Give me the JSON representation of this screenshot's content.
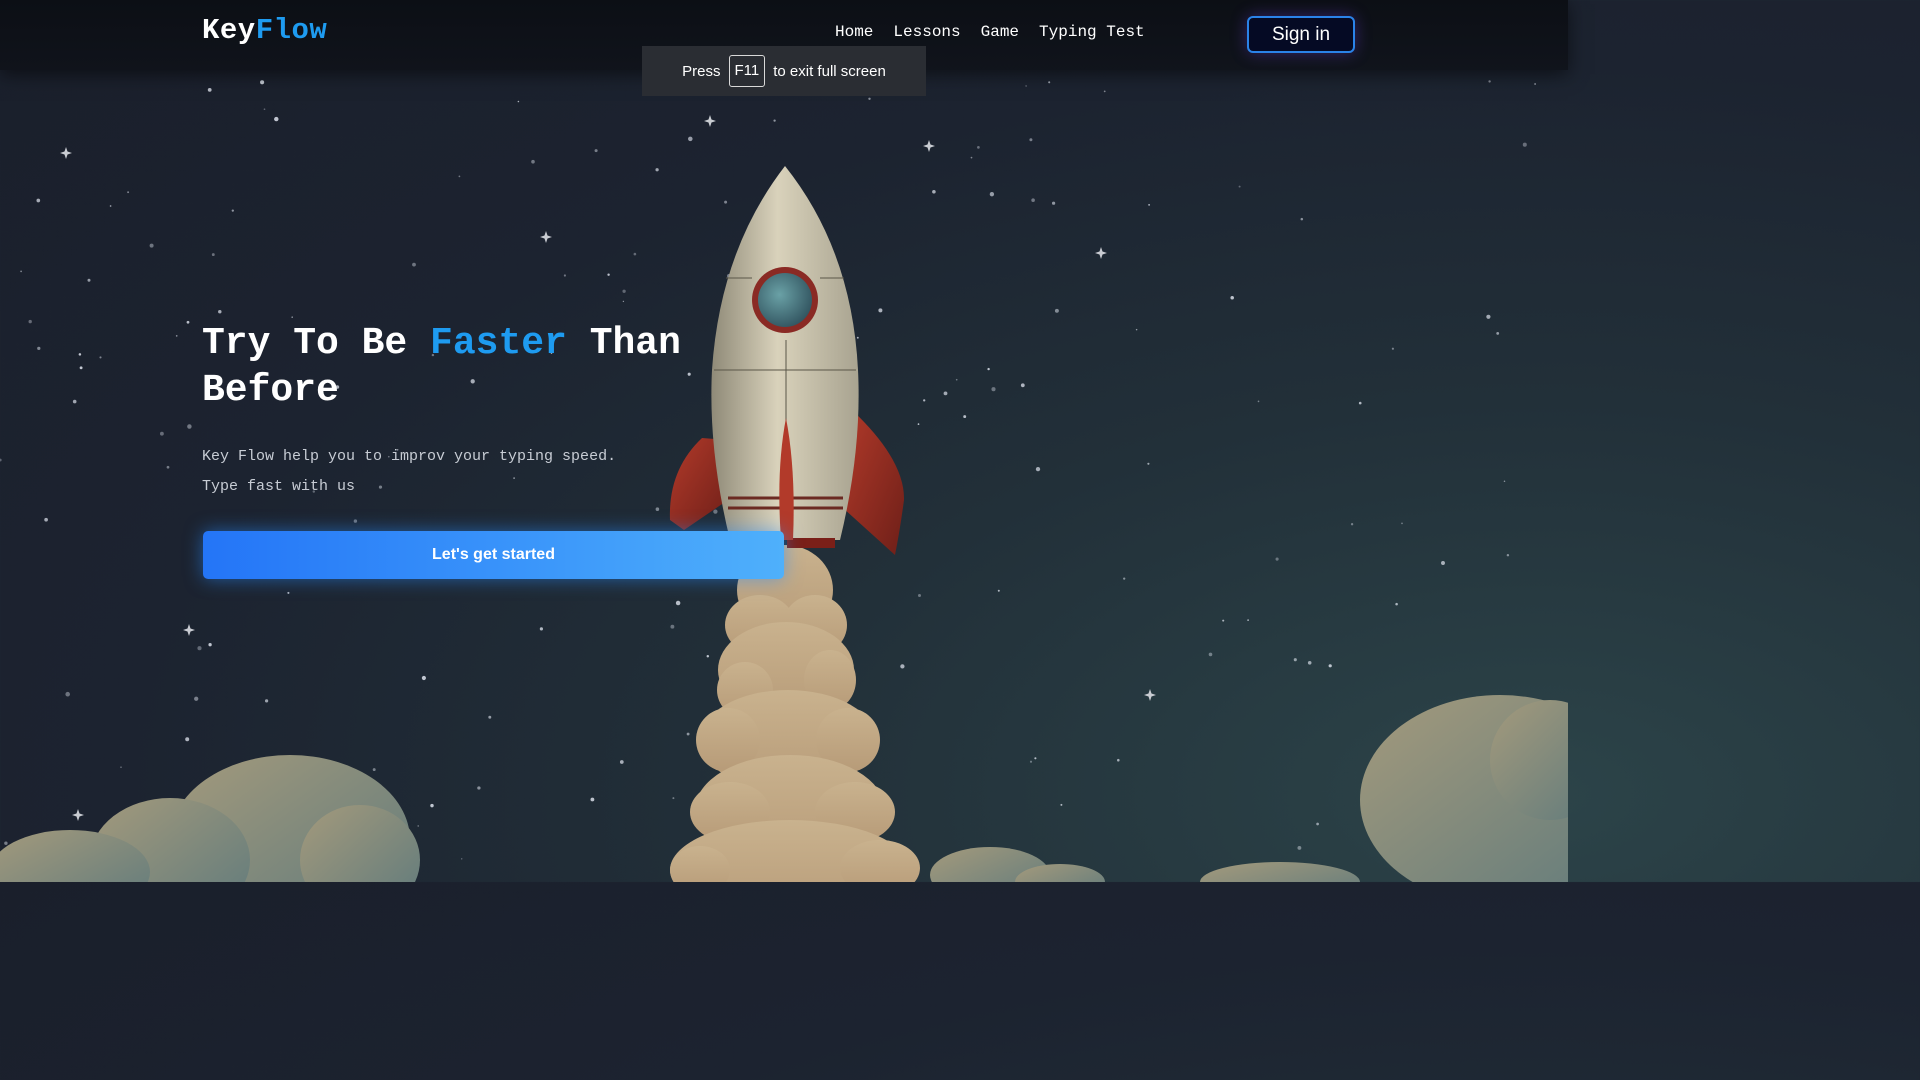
{
  "brand": {
    "part1": "Key",
    "part2": "Flow"
  },
  "nav": {
    "items": [
      {
        "label": "Home"
      },
      {
        "label": "Lessons"
      },
      {
        "label": "Game"
      },
      {
        "label": "Typing Test"
      }
    ],
    "signin_label": "Sign in"
  },
  "fullscreen_notice": {
    "before": "Press",
    "key": "F11",
    "after": "to exit full screen"
  },
  "hero": {
    "title_part1": "Try To Be",
    "title_accent": "Faster",
    "title_part2": "Than Before",
    "subtitle_line1": "Key Flow help you to improv your typing speed.",
    "subtitle_line2": "Type fast with us",
    "cta_label": "Let's get started"
  },
  "colors": {
    "accent": "#1e9bf0",
    "cta": "#2f86f8",
    "background": "#1c2330"
  },
  "icons": {
    "illustration": "rocket-launch-illustration"
  }
}
